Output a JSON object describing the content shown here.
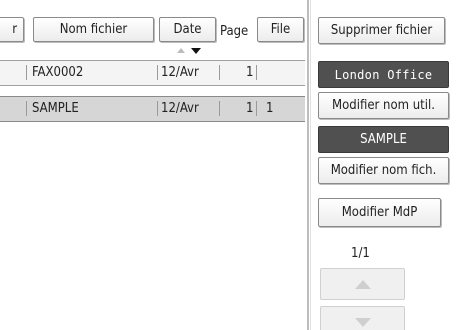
{
  "header": {
    "col_partial": "r",
    "col_filename": "Nom fichier",
    "col_date": "Date",
    "col_page": "Page",
    "col_file": "File"
  },
  "rows": [
    {
      "filename": "FAX0002",
      "date": "12/Avr",
      "pages": "1",
      "file": "",
      "selected": false
    },
    {
      "filename": "SAMPLE",
      "date": "12/Avr",
      "pages": "1",
      "file": "1",
      "selected": true
    }
  ],
  "sidebar": {
    "delete_file": "Supprimer fichier",
    "user_name": "London Office",
    "change_user_name": "Modifier nom util.",
    "file_name": "SAMPLE",
    "change_file_name": "Modifier nom fich.",
    "change_password": "Modifier MdP",
    "page_indicator": "1/1"
  },
  "colors": {
    "dark_button": "#505050",
    "selected_row": "#d6d6d6"
  }
}
